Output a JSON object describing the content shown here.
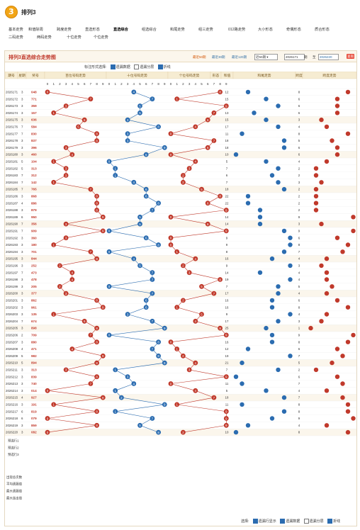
{
  "app": {
    "logo_text": "3",
    "title": "排列3"
  },
  "nav": {
    "row1": [
      "基本走势",
      "和值除周",
      "跨度走势",
      "直选形态",
      "直选综合",
      "组选综合",
      "和尾走势",
      "组三走势",
      "012路走势",
      "大小形态",
      "奇偶形态",
      "质合形态"
    ],
    "row2": [
      "二码走势",
      "两码走势",
      "十位走势",
      "个位走势"
    ],
    "active": "直选综合"
  },
  "panel": {
    "title": "排列3直选综合走势图",
    "filters": [
      "最近50期",
      "最近30期",
      "最近120期"
    ],
    "select_value": "近50期",
    "from_label": "2026171",
    "period_word": "期",
    "to_word": "至",
    "to_label": "2026220",
    "query_button": "查询"
  },
  "options": {
    "label": "标注形式选择:",
    "items": [
      {
        "label": "遗漏数据",
        "checked": true
      },
      {
        "label": "遗漏分层",
        "checked": false
      },
      {
        "label": "折线",
        "checked": true
      }
    ]
  },
  "table": {
    "headers": {
      "issue": "期号",
      "date": "星期",
      "prize": "奖号",
      "hundreds": "百位号码走势",
      "tens": "十位号码走势",
      "ones": "个位号码走势",
      "form": "形态",
      "sum": "和值",
      "span": "跨度",
      "sum_trend": "和尾走势",
      "span_trend": "跨度走势"
    },
    "rows": [
      [
        "2026171",
        "3",
        "048"
      ],
      [
        "2026172",
        "3",
        "771"
      ],
      [
        "2026173",
        "3",
        "359"
      ],
      [
        "2026174",
        "3",
        "157"
      ],
      [
        "2026175",
        "3",
        "636"
      ],
      [
        "2026176",
        "7",
        "584"
      ],
      [
        "2026177",
        "7",
        "830"
      ],
      [
        "2026178",
        "3",
        "837"
      ],
      [
        "2026179",
        "3",
        "396"
      ],
      [
        "2026180",
        "3",
        "460"
      ],
      [
        "2026181",
        "5",
        "104"
      ],
      [
        "2026182",
        "5",
        "313"
      ],
      [
        "2026183",
        "7",
        "312"
      ],
      [
        "2026184",
        "7",
        "142"
      ],
      [
        "2026185",
        "7",
        "765"
      ],
      [
        "2026186",
        "3",
        "868"
      ],
      [
        "2026187",
        "4",
        "886"
      ],
      [
        "2026188",
        "3",
        "879"
      ],
      [
        "2026189",
        "6",
        "950"
      ],
      [
        "2026190",
        "7",
        "356"
      ],
      [
        "2026191",
        "7",
        "909"
      ],
      [
        "2026192",
        "3",
        "360"
      ],
      [
        "2026193",
        "3",
        "180"
      ],
      [
        "2026194",
        "3",
        "701"
      ],
      [
        "2026195",
        "3",
        "844"
      ],
      [
        "2026196",
        "3",
        "252"
      ],
      [
        "2026197",
        "7",
        "473"
      ],
      [
        "2026198",
        "3",
        "478"
      ],
      [
        "2026199",
        "3",
        "205"
      ],
      [
        "2026200",
        "3",
        "377"
      ],
      [
        "2026201",
        "3",
        "862"
      ],
      [
        "2026202",
        "3",
        "961"
      ],
      [
        "2026203",
        "3",
        "135"
      ],
      [
        "2026204",
        "7",
        "674"
      ],
      [
        "2026205",
        "3",
        "898"
      ],
      [
        "2026206",
        "2",
        "709"
      ],
      [
        "2026207",
        "3",
        "880"
      ],
      [
        "2026208",
        "4",
        "471"
      ],
      [
        "2026209",
        "5",
        "982"
      ],
      [
        "2026210",
        "5",
        "894"
      ],
      [
        "2026211",
        "3",
        "313"
      ],
      [
        "2026212",
        "3",
        "839"
      ],
      [
        "2026213",
        "3",
        "740"
      ],
      [
        "2026214",
        "3",
        "014"
      ],
      [
        "2026215",
        "4",
        "927"
      ],
      [
        "2026216",
        "3",
        "191"
      ],
      [
        "2026217",
        "6",
        "819"
      ],
      [
        "2026218",
        "6",
        "079"
      ],
      [
        "2026219",
        "3",
        "859"
      ],
      [
        "2026220",
        "3",
        "082"
      ]
    ],
    "forecast_labels": [
      "预选行1",
      "预选行2",
      "预选行3"
    ],
    "stat_labels": [
      "出现总次数",
      "平均遗漏值",
      "最大遗漏值",
      "最大连出值"
    ]
  },
  "bottom": {
    "label": "选择:",
    "items": [
      "遗漏行显示",
      "遗漏数据",
      "遗漏分层",
      "折线"
    ]
  }
}
